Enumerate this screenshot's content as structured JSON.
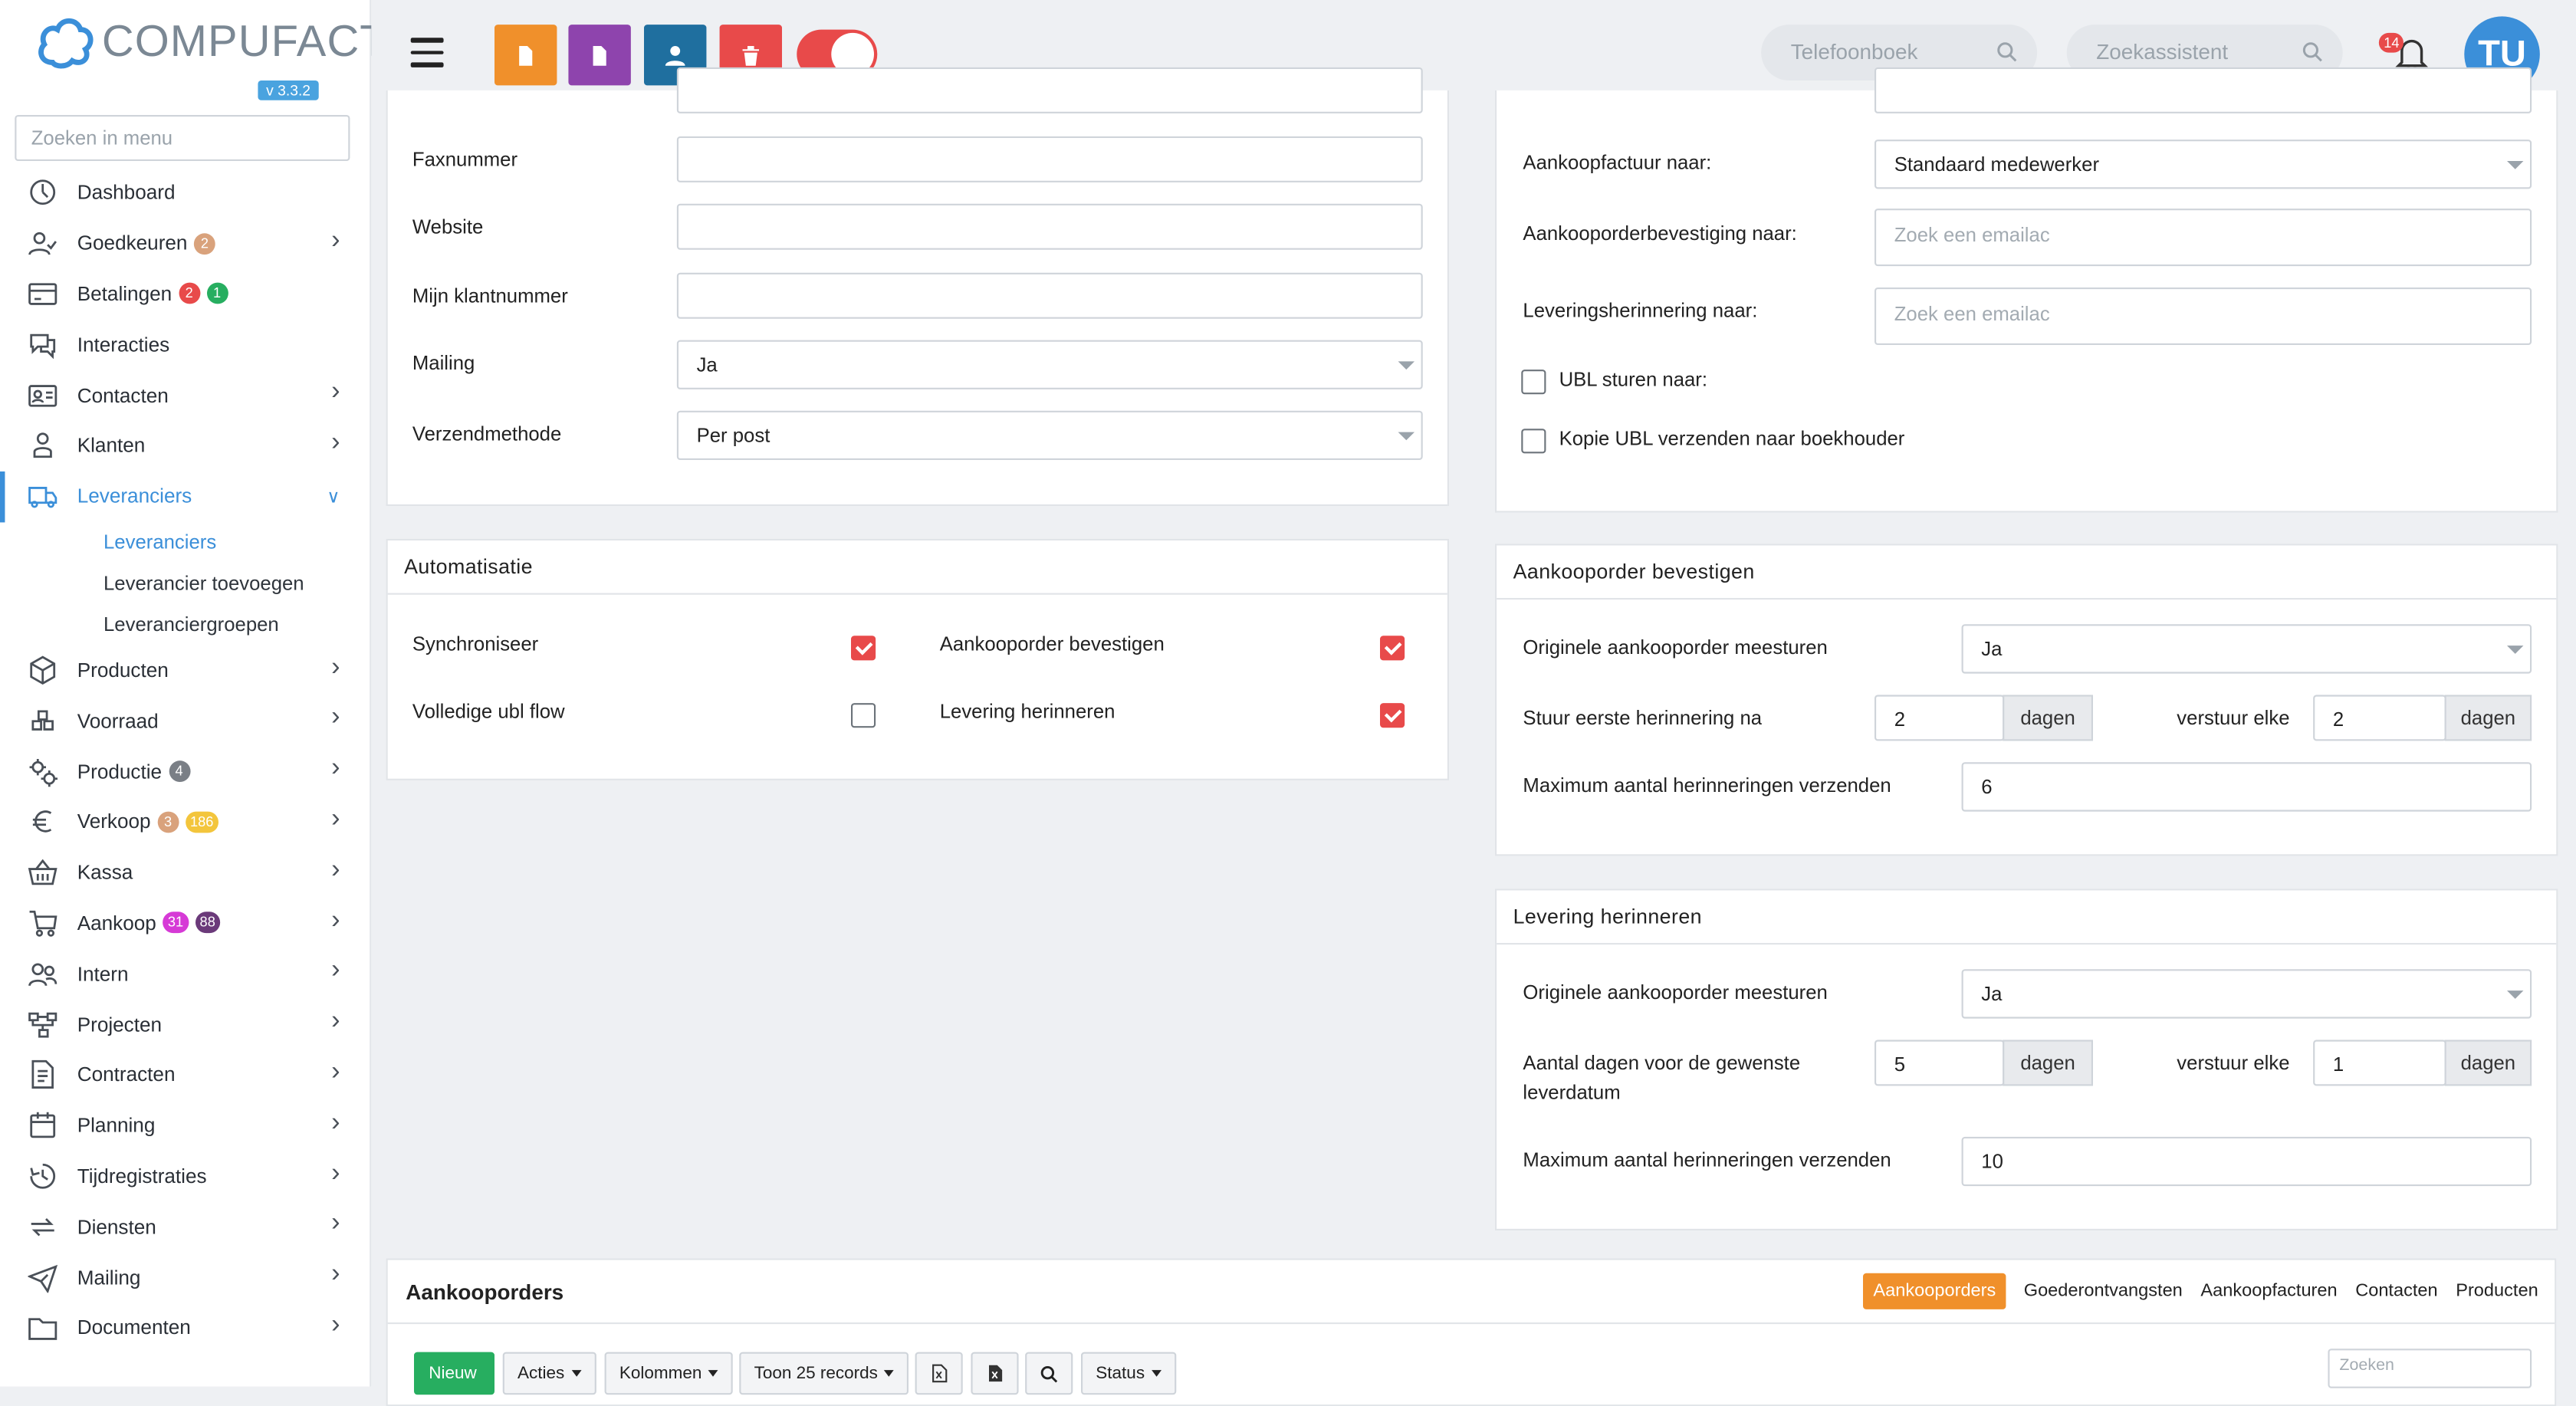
{
  "app": {
    "logo_text": "COMPUFACT",
    "version": "v 3.3.2"
  },
  "sidebar": {
    "search_placeholder": "Zoeken in menu",
    "items": [
      {
        "label": "Dashboard",
        "icon": "dashboard-icon"
      },
      {
        "label": "Goedkeuren",
        "icon": "user-check-icon",
        "badges": [
          {
            "text": "2",
            "color": "#d9a27c"
          }
        ],
        "chevron": true
      },
      {
        "label": "Betalingen",
        "icon": "payments-icon",
        "badges": [
          {
            "text": "2",
            "color": "#e84a4a"
          },
          {
            "text": "1",
            "color": "#27ae60"
          }
        ]
      },
      {
        "label": "Interacties",
        "icon": "chat-icon"
      },
      {
        "label": "Contacten",
        "icon": "contact-card-icon",
        "chevron": true
      },
      {
        "label": "Klanten",
        "icon": "customer-icon",
        "chevron": true
      },
      {
        "label": "Leveranciers",
        "icon": "truck-icon",
        "active": true,
        "chevron": true
      },
      {
        "label": "Producten",
        "icon": "box-icon",
        "chevron": true
      },
      {
        "label": "Voorraad",
        "icon": "stock-icon",
        "chevron": true
      },
      {
        "label": "Productie",
        "icon": "gears-icon",
        "badges": [
          {
            "text": "4",
            "color": "#7a7f86"
          }
        ],
        "chevron": true
      },
      {
        "label": "Verkoop",
        "icon": "euro-icon",
        "badges": [
          {
            "text": "3",
            "color": "#d9a27c"
          },
          {
            "text": "186",
            "color": "#f3c53c"
          }
        ],
        "chevron": true
      },
      {
        "label": "Kassa",
        "icon": "basket-icon",
        "chevron": true
      },
      {
        "label": "Aankoop",
        "icon": "cart-icon",
        "badges": [
          {
            "text": "31",
            "color": "#d63ad6"
          },
          {
            "text": "88",
            "color": "#6b3a7a"
          }
        ],
        "chevron": true
      },
      {
        "label": "Intern",
        "icon": "users-icon",
        "chevron": true
      },
      {
        "label": "Projecten",
        "icon": "project-icon",
        "chevron": true
      },
      {
        "label": "Contracten",
        "icon": "contract-icon",
        "chevron": true
      },
      {
        "label": "Planning",
        "icon": "calendar-icon",
        "chevron": true
      },
      {
        "label": "Tijdregistraties",
        "icon": "clock-icon",
        "chevron": true
      },
      {
        "label": "Diensten",
        "icon": "repeat-icon",
        "chevron": true
      },
      {
        "label": "Mailing",
        "icon": "send-icon",
        "chevron": true
      },
      {
        "label": "Documenten",
        "icon": "folder-icon",
        "chevron": true
      }
    ],
    "sub_items": [
      {
        "label": "Leveranciers",
        "active": true
      },
      {
        "label": "Leverancier toevoegen"
      },
      {
        "label": "Leveranciergroepen"
      }
    ]
  },
  "topbar": {
    "phonebook_placeholder": "Telefoonboek",
    "assistant_placeholder": "Zoekassistent",
    "notif_count": "14",
    "avatar": "TU",
    "colors": {
      "orange": "#f0902b",
      "purple": "#8e44ad",
      "blue": "#1f6f9f",
      "red": "#e84a4a"
    }
  },
  "left_form": {
    "faxnummer": {
      "label": "Faxnummer",
      "value": ""
    },
    "website": {
      "label": "Website",
      "value": ""
    },
    "klantnummer": {
      "label": "Mijn klantnummer",
      "value": ""
    },
    "mailing": {
      "label": "Mailing",
      "value": "Ja"
    },
    "verzendmethode": {
      "label": "Verzendmethode",
      "value": "Per post"
    }
  },
  "automatisatie": {
    "title": "Automatisatie",
    "synchroniseer": {
      "label": "Synchroniseer",
      "checked": true
    },
    "volledige_ubl": {
      "label": "Volledige ubl flow",
      "checked": false
    },
    "aankooporder_bevestigen": {
      "label": "Aankooporder bevestigen",
      "checked": true
    },
    "levering_herinneren": {
      "label": "Levering herinneren",
      "checked": true
    }
  },
  "right_form": {
    "aankoopfactuur": {
      "label": "Aankoopfactuur naar:",
      "value": "Standaard medewerker"
    },
    "aankooporderbevestiging": {
      "label": "Aankooporderbevestiging naar:",
      "placeholder": "Zoek een emailac"
    },
    "leveringsherinnering": {
      "label": "Leveringsherinnering naar:",
      "placeholder": "Zoek een emailac"
    },
    "ubl_sturen": {
      "label": "UBL sturen naar:",
      "checked": false
    },
    "kopie_ubl": {
      "label": "Kopie UBL verzenden naar boekhouder",
      "checked": false
    }
  },
  "bevestigen": {
    "title": "Aankooporder bevestigen",
    "originele_label": "Originele aankooporder meesturen",
    "originele_value": "Ja",
    "eerste_label": "Stuur eerste herinnering na",
    "eerste_value": "2",
    "unit": "dagen",
    "elke_label": "verstuur elke",
    "elke_value": "2",
    "max_label": "Maximum aantal herinneringen verzenden",
    "max_value": "6"
  },
  "herinneren": {
    "title": "Levering herinneren",
    "originele_label": "Originele aankooporder meesturen",
    "originele_value": "Ja",
    "dagen_label_1": "Aantal dagen voor de gewenste",
    "dagen_label_2": "leverdatum",
    "dagen_value": "5",
    "unit": "dagen",
    "elke_label": "verstuur elke",
    "elke_value": "1",
    "max_label": "Maximum aantal herinneringen verzenden",
    "max_value": "10"
  },
  "aankooporders": {
    "title": "Aankooporders",
    "tabs": [
      "Aankooporders",
      "Goederontvangsten",
      "Aankoopfacturen",
      "Contacten",
      "Producten"
    ],
    "toolbar": {
      "nieuw": "Nieuw",
      "acties": "Acties",
      "kolommen": "Kolommen",
      "toon": "Toon 25 records",
      "status": "Status"
    },
    "search_placeholder": "Zoeken"
  }
}
